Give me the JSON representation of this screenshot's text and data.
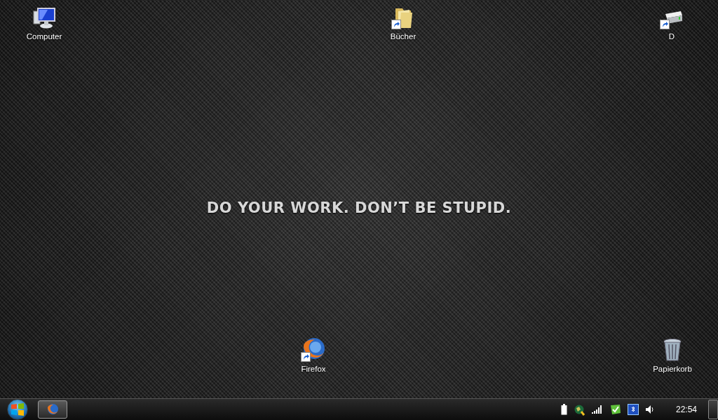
{
  "desktop": {
    "wallpaper_text": "DO YOUR WORK. DON’T BE STUPID.",
    "icons": [
      {
        "label": "Computer",
        "kind": "computer",
        "shortcut": false
      },
      {
        "label": "Bücher",
        "kind": "folder",
        "shortcut": true
      },
      {
        "label": "D",
        "kind": "drive",
        "shortcut": true
      },
      {
        "label": "Firefox",
        "kind": "firefox",
        "shortcut": true
      },
      {
        "label": "Papierkorb",
        "kind": "recycle-bin",
        "shortcut": false
      }
    ]
  },
  "taskbar": {
    "buttons": [
      {
        "kind": "firefox"
      }
    ],
    "tray": [
      {
        "kind": "battery"
      },
      {
        "kind": "globe"
      },
      {
        "kind": "signal"
      },
      {
        "kind": "check"
      },
      {
        "kind": "bluetooth"
      },
      {
        "kind": "volume"
      }
    ],
    "clock": "22:54"
  }
}
